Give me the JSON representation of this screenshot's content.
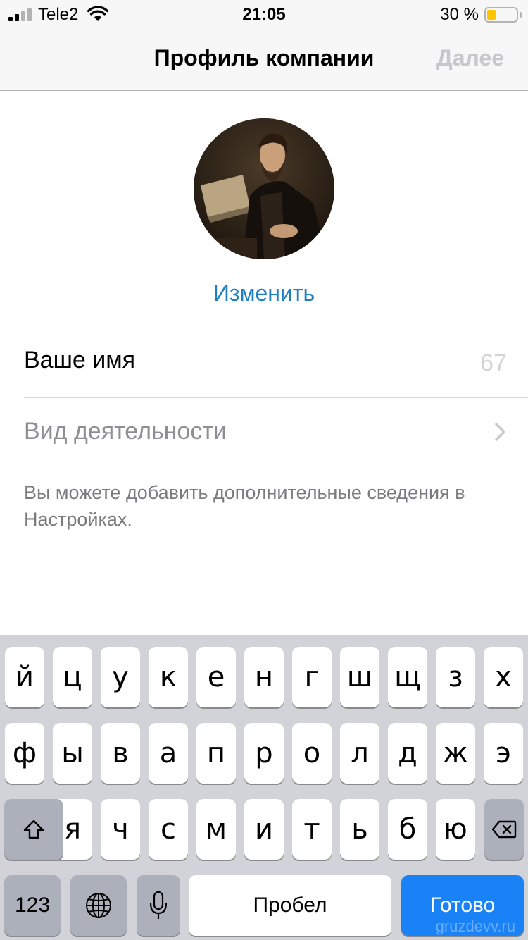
{
  "status_bar": {
    "carrier": "Tele2",
    "time": "21:05",
    "battery_percent": "30 %",
    "battery_level": 0.3,
    "battery_color": "#ffc400",
    "signal_bars_filled": 2,
    "signal_bars_total": 4
  },
  "nav": {
    "title": "Профиль компании",
    "next_label": "Далее"
  },
  "profile": {
    "avatar_icon": "portrait-photo",
    "change_label": "Изменить"
  },
  "form": {
    "name_placeholder": "Ваше имя",
    "name_value": "",
    "name_counter": "67",
    "activity_label": "Вид деятельности",
    "hint": "Вы можете добавить дополнительные сведения в Настройках."
  },
  "keyboard": {
    "row1": [
      "й",
      "ц",
      "у",
      "к",
      "е",
      "н",
      "г",
      "ш",
      "щ",
      "з",
      "х"
    ],
    "row2": [
      "ф",
      "ы",
      "в",
      "а",
      "п",
      "р",
      "о",
      "л",
      "д",
      "ж",
      "э"
    ],
    "row3": [
      "я",
      "ч",
      "с",
      "м",
      "и",
      "т",
      "ь",
      "б",
      "ю"
    ],
    "numbers_label": "123",
    "space_label": "Пробел",
    "done_label": "Готово",
    "shift_icon": "shift-icon",
    "delete_icon": "backspace-icon",
    "globe_icon": "globe-icon",
    "mic_icon": "microphone-icon"
  },
  "colors": {
    "accent": "#1f7fc0",
    "done_key": "#1a82f7",
    "disabled": "#c7c7cc"
  },
  "watermark": "gruzdevv.ru"
}
